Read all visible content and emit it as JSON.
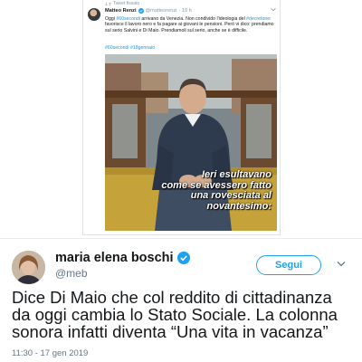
{
  "embedded_tweet": {
    "retweet_label": "Tweet fissato",
    "author_name": "Matteo Renzi",
    "author_handle": "@matteorenzi",
    "time": "· 19 h",
    "text_parts": {
      "p1": "Oggi ",
      "h1": "#60secondi",
      "p2": " arrivano da Venezia. Non condivido l'ideologia del ",
      "h2": "#decretone",
      "p3": ": favorisce il lavoro nero e fa pagare ai giovani le pensioni. Però vi dico: prendiamo sul serio Salvini e Di Maio. Prendiamoli sul serio, anche se è difficile."
    },
    "hashtags": "#60secondi #18gennaio",
    "video_caption": {
      "line1": "Ieri esultavano",
      "line2": "come se avessero fatto",
      "line3": "una rovesciata al novantesimo:"
    },
    "icons": {
      "retweet": "pin-icon",
      "verified": "verified-badge-icon",
      "more": "chevron-down-icon"
    }
  },
  "main_tweet": {
    "author_name": "maria elena boschi",
    "author_handle": "@meb",
    "follow_label": "Segui",
    "text_lines": [
      "Dice Di Maio che col reddito di cittadinanza",
      "da oggi cambia lo Stato Sociale. La colonna",
      "sonora infatti diventa “Una vita in vacanza”"
    ],
    "timestamp": "11:30 - 17 gen 2019",
    "colors": {
      "accent": "#1da1f2",
      "text": "#14171a",
      "muted": "#657786"
    }
  }
}
